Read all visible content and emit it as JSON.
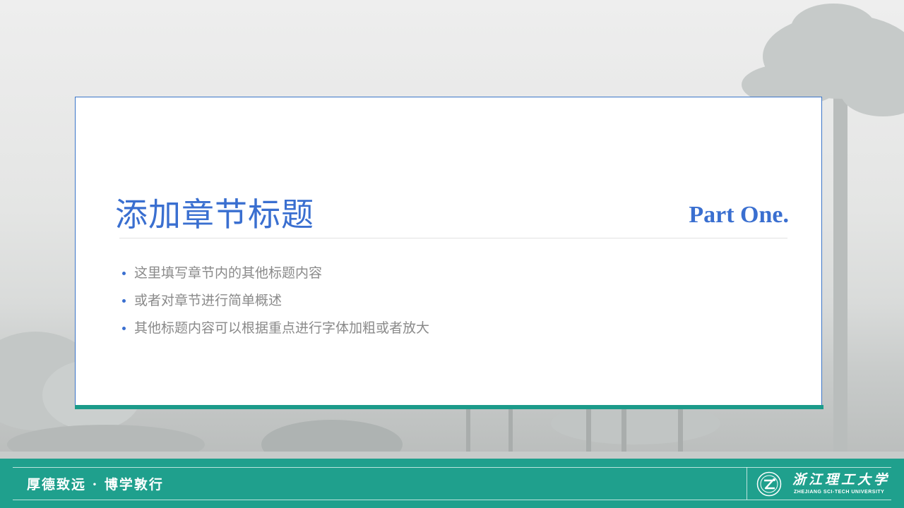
{
  "slide": {
    "title": "添加章节标题",
    "part_label": "Part One.",
    "bullets": [
      "这里填写章节内的其他标题内容",
      "或者对章节进行简单概述",
      "其他标题内容可以根据重点进行字体加粗或者放大"
    ]
  },
  "footer": {
    "motto": "厚德致远 · 博学敦行",
    "university_cn": "浙江理工大学",
    "university_en": "ZHEJIANG SCI-TECH UNIVERSITY",
    "logo_icon": "university-emblem-icon"
  },
  "colors": {
    "accent_blue": "#3a6fd0",
    "teal": "#1fa08d",
    "bullet_text": "#8a8a8a"
  }
}
